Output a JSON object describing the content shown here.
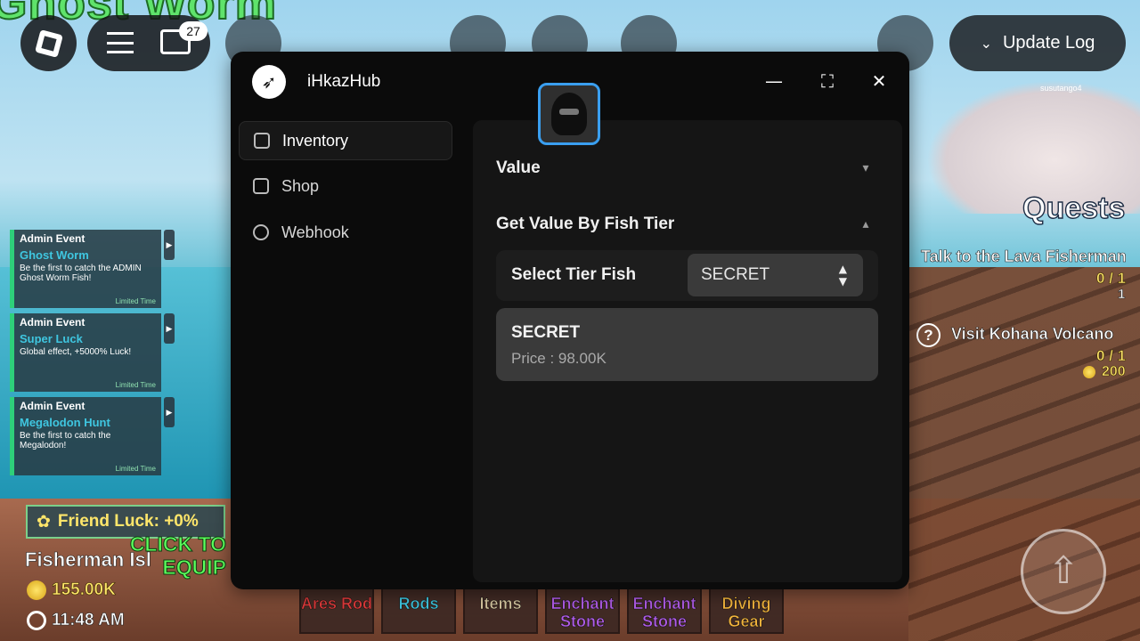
{
  "game": {
    "banner_title": "Ghost Worm",
    "chat_badge": "27",
    "update_log_label": "Update Log",
    "events": [
      {
        "type": "Admin Event",
        "name": "Ghost Worm",
        "desc": "Be the first to catch the ADMIN Ghost Worm Fish!",
        "limited": "Limited Time"
      },
      {
        "type": "Admin Event",
        "name": "Super Luck",
        "desc": "Global effect, +5000% Luck!",
        "limited": "Limited Time"
      },
      {
        "type": "Admin Event",
        "name": "Megalodon Hunt",
        "desc": "Be the first to catch the Megalodon!",
        "limited": "Limited Time"
      }
    ],
    "friend_luck": "Friend Luck:  +0%",
    "click_to_equip": "CLICK TO EQUIP",
    "location": "Fisherman Isl",
    "coins": "155.00K",
    "time": "11:48 AM",
    "quests": {
      "title": "Quests",
      "items": [
        {
          "text": "Talk to the Lava Fisherman",
          "progress": "0 / 1",
          "reward": "1"
        },
        {
          "text": "Visit Kohana Volcano",
          "progress": "0 / 1",
          "reward": "200"
        }
      ]
    },
    "player_tag": "susutango4",
    "hotbar": [
      {
        "label": "Ares Rod",
        "color": "#e23b3b"
      },
      {
        "label": "Rods",
        "color": "#3fc6e0"
      },
      {
        "label": "Items",
        "color": "#d8c7a0"
      },
      {
        "label": "Enchant Stone",
        "color": "#b15ce8"
      },
      {
        "label": "Enchant Stone",
        "color": "#b15ce8"
      },
      {
        "label": "Diving Gear",
        "color": "#f2b33c"
      }
    ]
  },
  "hub": {
    "title": "iHkazHub",
    "nav": [
      {
        "label": "Inventory",
        "icon": "backpack-icon",
        "active": true
      },
      {
        "label": "Shop",
        "icon": "store-icon",
        "active": false
      },
      {
        "label": "Webhook",
        "icon": "webhook-icon",
        "active": false
      }
    ],
    "sections": {
      "value_title": "Value",
      "tier_title": "Get Value By Fish Tier"
    },
    "select": {
      "label": "Select Tier Fish",
      "value": "SECRET"
    },
    "result": {
      "name": "SECRET",
      "price": "Price : 98.00K"
    }
  }
}
